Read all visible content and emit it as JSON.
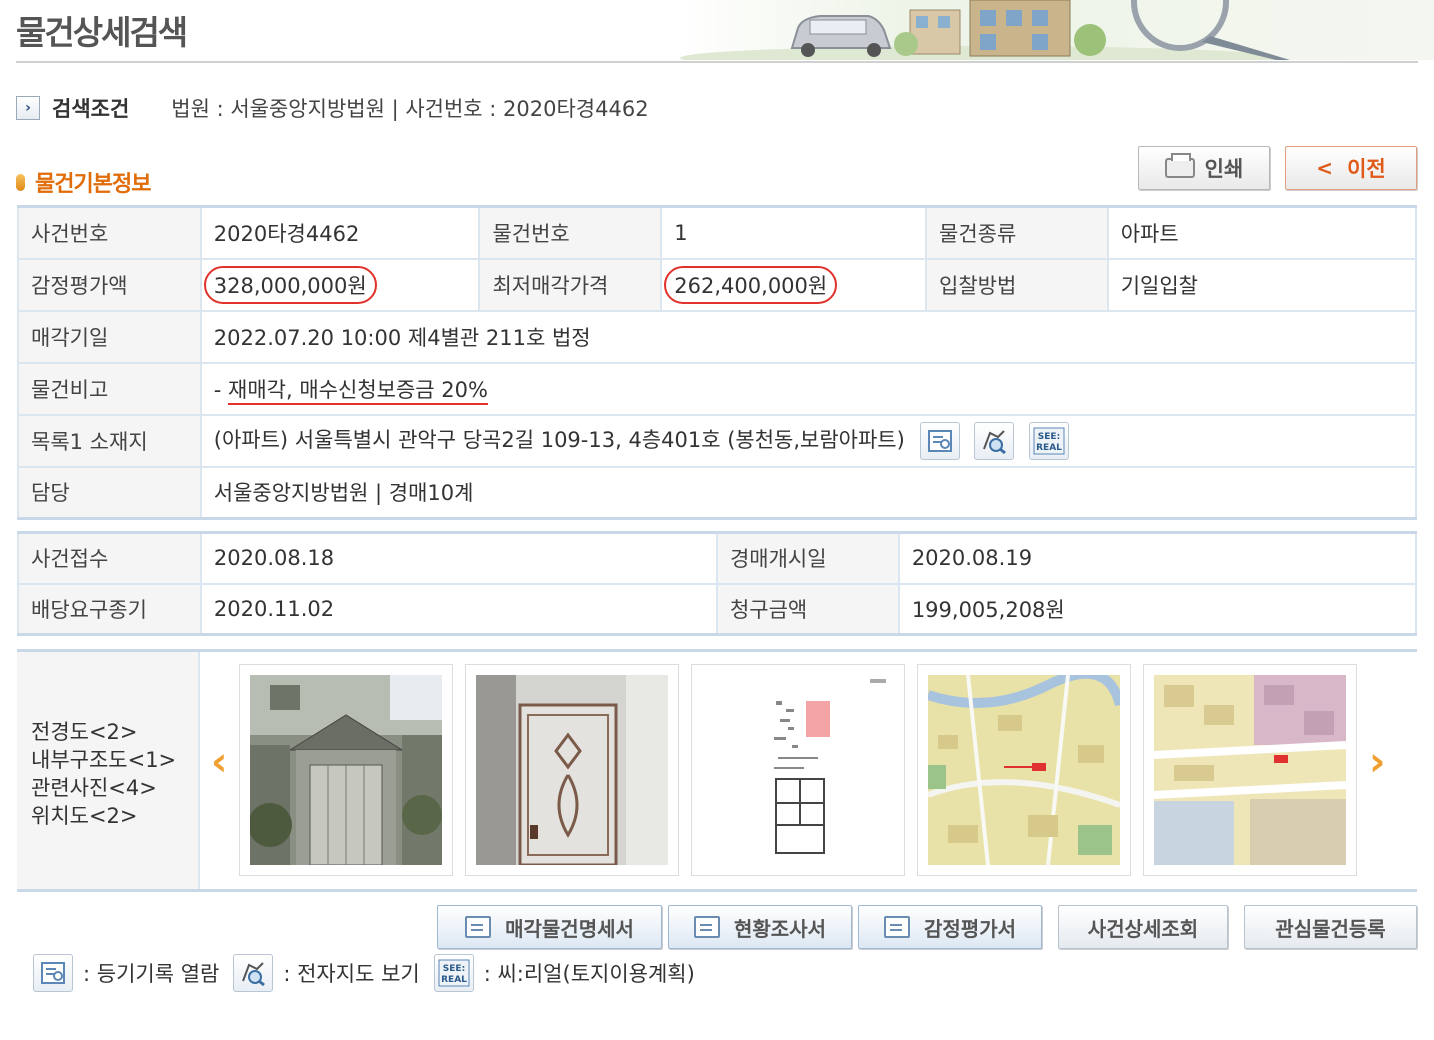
{
  "page_title": "물건상세검색",
  "search_condition": {
    "label": "검색조건",
    "text": "법원 : 서울중앙지방법원 | 사건번호 : 2020타경4462"
  },
  "section_title": "물건기본정보",
  "top_buttons": {
    "print": "인쇄",
    "prev": "이전"
  },
  "basic_info": {
    "case_no_label": "사건번호",
    "case_no": "2020타경4462",
    "item_no_label": "물건번호",
    "item_no": "1",
    "item_type_label": "물건종류",
    "item_type": "아파트",
    "appraisal_label": "감정평가액",
    "appraisal": "328,000,000원",
    "min_price_label": "최저매각가격",
    "min_price": "262,400,000원",
    "bid_method_label": "입찰방법",
    "bid_method": "기일입찰",
    "sale_date_label": "매각기일",
    "sale_date": "2022.07.20 10:00 제4별관 211호 법정",
    "remark_label": "물건비고",
    "remark_prefix": "- ",
    "remark": "재매각, 매수신청보증금 20%",
    "location_label": "목록1 소재지",
    "location": "(아파트) 서울특별시 관악구 당곡2길 109-13, 4층401호 (봉천동,보람아파트)",
    "dept_label": "담당",
    "dept": "서울중앙지방법원 | 경매10계"
  },
  "case_info": {
    "received_label": "사건접수",
    "received": "2020.08.18",
    "start_label": "경매개시일",
    "start": "2020.08.19",
    "deadline_label": "배당요구종기",
    "deadline": "2020.11.02",
    "claim_label": "청구금액",
    "claim": "199,005,208원"
  },
  "photos": {
    "labels": [
      "전경도<2>",
      "내부구조도<1>",
      "관련사진<4>",
      "위치도<2>"
    ]
  },
  "bottom_buttons": [
    "매각물건명세서",
    "현황조사서",
    "감정평가서",
    "사건상세조회",
    "관심물건등록"
  ],
  "legend": {
    "registry": ": 등기기록 열람",
    "emap": ": 전자지도 보기",
    "seereal": ": 씨:리얼(토지이용계획)"
  },
  "icon_text": {
    "seereal_top": "SEE:",
    "seereal_bottom": "REAL"
  },
  "colors": {
    "accent_orange": "#e06d0a",
    "circle_red": "#e0322a",
    "table_border": "#c9d8e8"
  }
}
